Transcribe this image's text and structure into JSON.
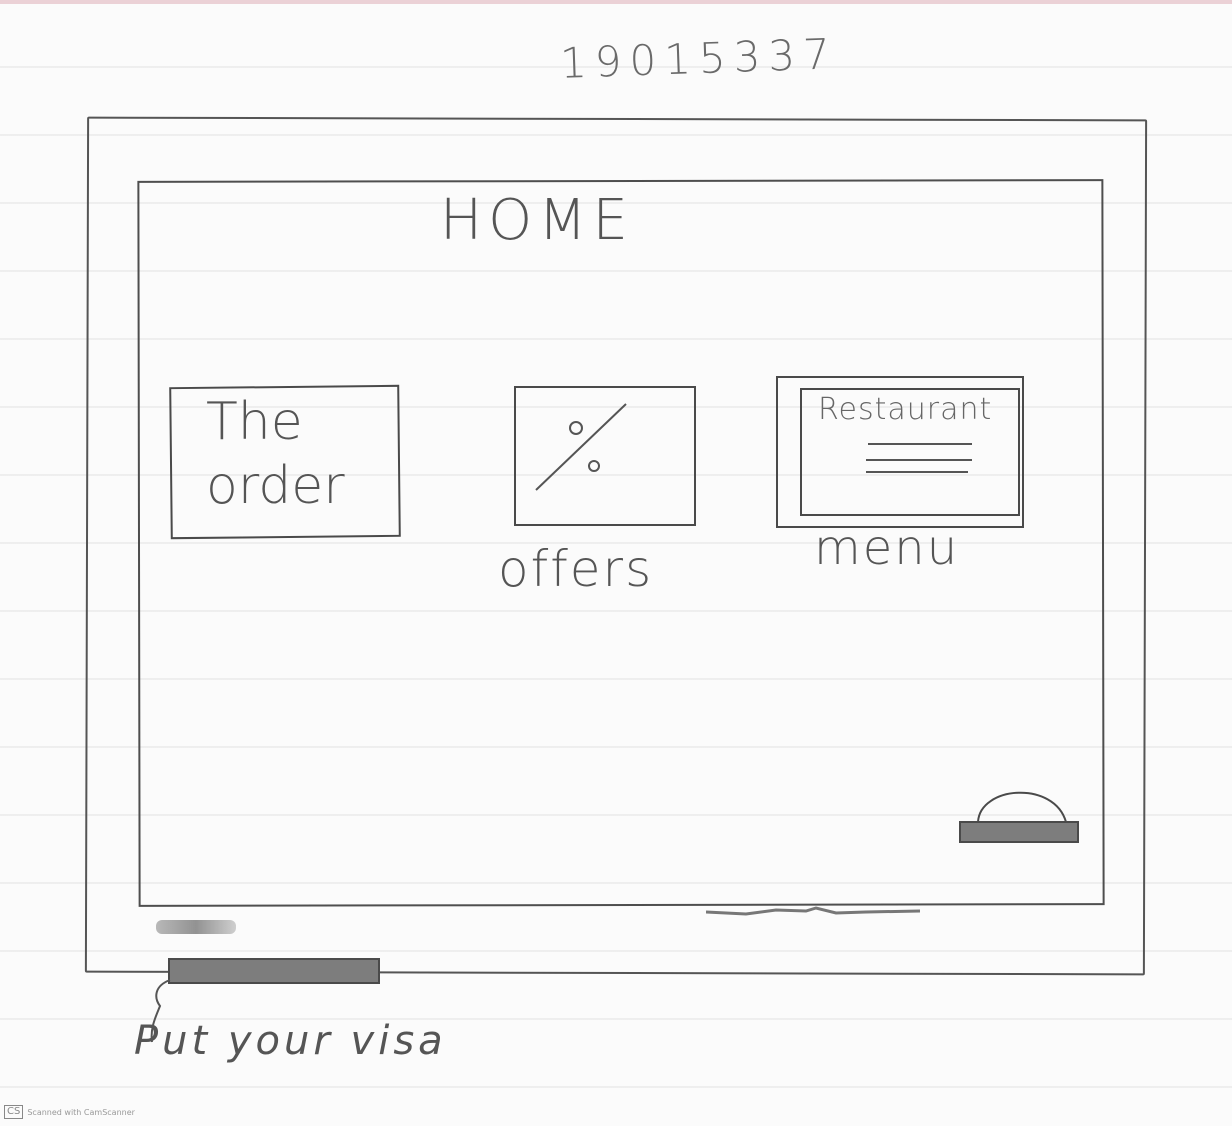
{
  "sketch": {
    "student_id": "19015337",
    "screen_title": "HOME",
    "tiles": {
      "order": {
        "label_line1": "The",
        "label_line2": "order"
      },
      "offers": {
        "icon_text": "%",
        "label": "offers"
      },
      "menu": {
        "card_text": "Restaurant",
        "label": "menu"
      }
    },
    "visa_label": "Put your visa"
  },
  "footer": {
    "logo": "CS",
    "text": "Scanned with CamScanner"
  },
  "icons": [
    "percent-icon",
    "menu-lines-icon",
    "dome-icon",
    "arrow-icon"
  ]
}
